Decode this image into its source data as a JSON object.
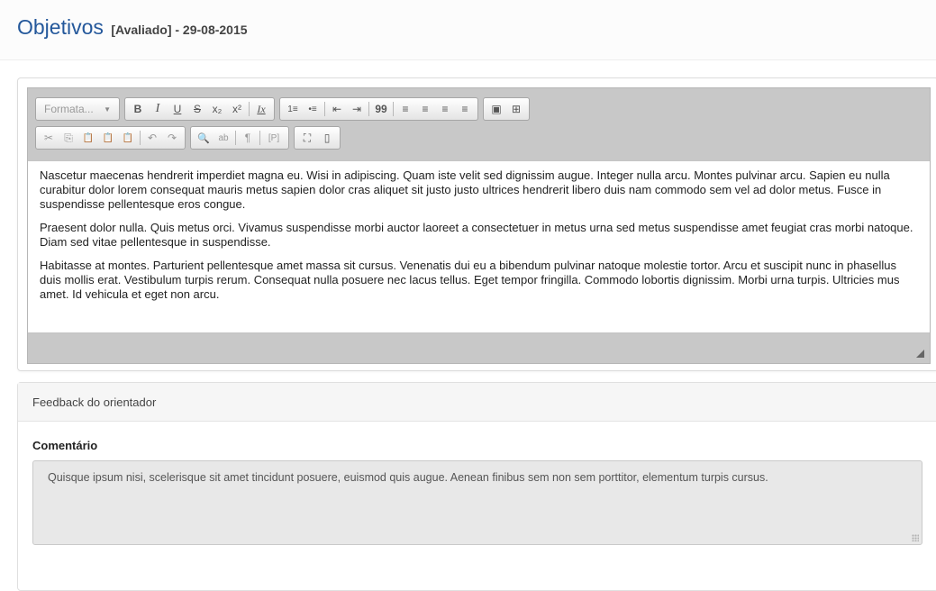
{
  "header": {
    "title": "Objetivos",
    "subtitle": "[Avaliado] - 29-08-2015"
  },
  "editor": {
    "toolbar": {
      "format_label": "Formata...",
      "bold": "B",
      "italic": "I",
      "underline": "U",
      "strike": "S",
      "subscript": "x₂",
      "superscript": "x²",
      "remove_format": "Ix",
      "numbered_list": "1≡",
      "bulleted_list": "•≡",
      "outdent": "⇤",
      "indent": "⇥",
      "blockquote": "99",
      "align_left": "≡",
      "align_center": "≡",
      "align_right": "≡",
      "justify": "≡",
      "image": "▣",
      "table": "⊞",
      "cut": "✂",
      "copy": "⎘",
      "paste": "📋",
      "paste_text": "📋",
      "paste_word": "📋",
      "undo": "↶",
      "redo": "↷",
      "find": "🔍",
      "replace": "ab",
      "show_blocks": "¶",
      "paragraph_tag": "[P]",
      "maximize": "⛶",
      "source": "▯"
    },
    "paragraphs": [
      "Nascetur maecenas hendrerit imperdiet magna eu. Wisi in adipiscing. Quam iste velit sed dignissim augue. Integer nulla arcu. Montes pulvinar arcu. Sapien eu nulla curabitur dolor lorem consequat mauris metus sapien dolor cras aliquet sit justo justo ultrices hendrerit libero duis nam commodo sem vel ad dolor metus. Fusce in suspendisse pellentesque eros congue.",
      "Praesent dolor nulla. Quis metus orci. Vivamus suspendisse morbi auctor laoreet a consectetuer in metus urna sed metus suspendisse amet feugiat cras morbi natoque. Diam sed vitae pellentesque in suspendisse.",
      "Habitasse at montes. Parturient pellentesque amet massa sit cursus. Venenatis dui eu a bibendum pulvinar natoque molestie tortor. Arcu et suscipit nunc in phasellus duis mollis erat. Vestibulum turpis rerum. Consequat nulla posuere nec lacus tellus. Eget tempor fringilla. Commodo lobortis dignissim. Morbi urna turpis. Ultricies mus amet. Id vehicula et eget non arcu."
    ]
  },
  "feedback": {
    "heading": "Feedback do orientador",
    "comment_label": "Comentário",
    "comment_text": "Quisque ipsum nisi, scelerisque sit amet tincidunt posuere, euismod quis augue. Aenean finibus sem non sem porttitor, elementum turpis cursus."
  },
  "colors": {
    "title": "#24589b",
    "toolbar_bg": "#c8c8c8",
    "comment_bg": "#e8e8e8"
  }
}
